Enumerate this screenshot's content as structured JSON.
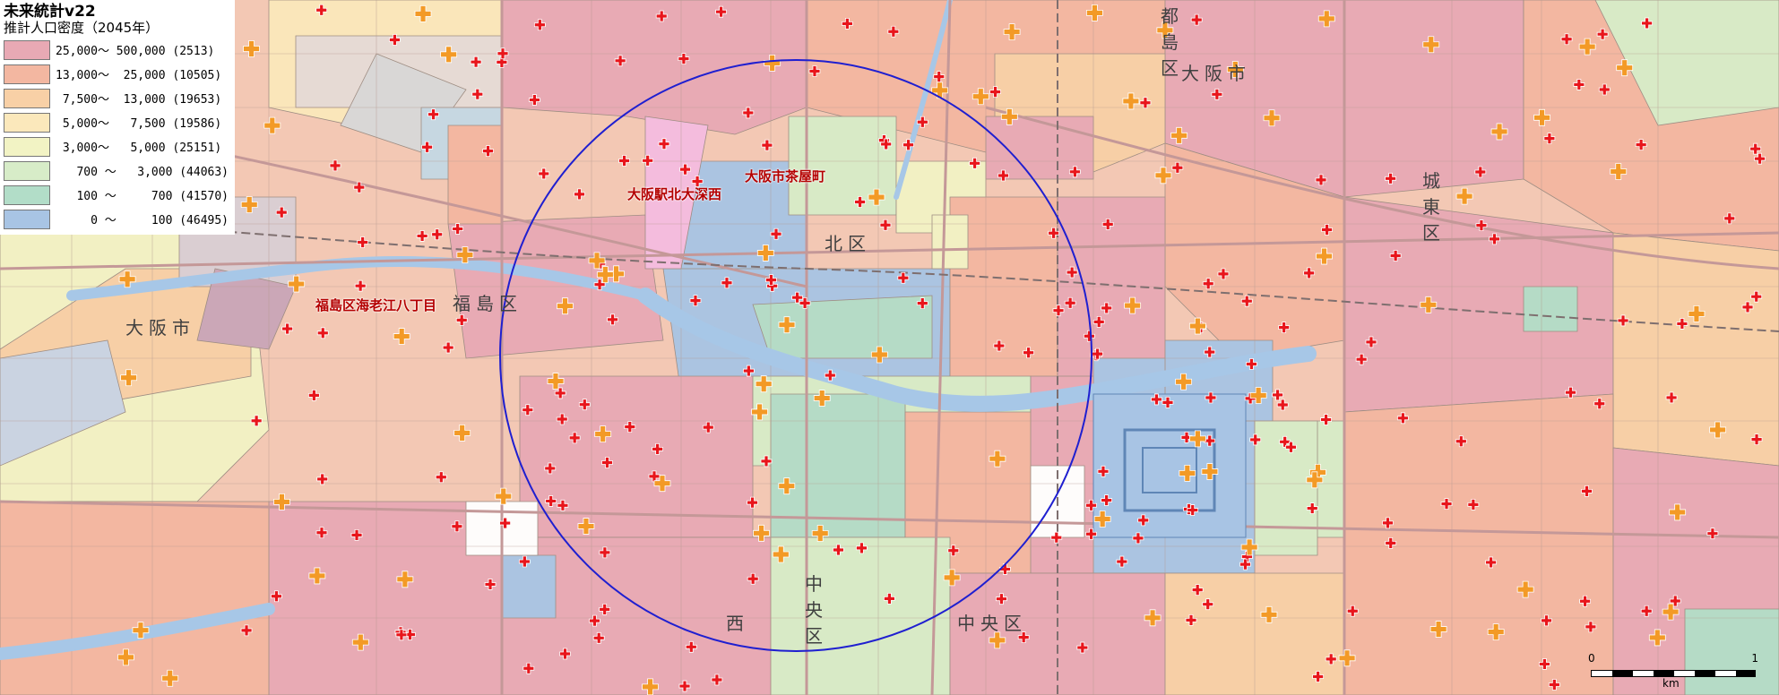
{
  "legend": {
    "title": "未来統計v22",
    "subtitle": "推計人口密度（2045年）",
    "classes": [
      {
        "range": "25,000～ 500,000 (2513)",
        "color": "#e8a9b4"
      },
      {
        "range": "13,000～  25,000 (10505)",
        "color": "#f3b7a1"
      },
      {
        "range": " 7,500～  13,000 (19653)",
        "color": "#f8d0a6"
      },
      {
        "range": " 5,000～   7,500 (19586)",
        "color": "#fbe8bb"
      },
      {
        "range": " 3,000～   5,000 (25151)",
        "color": "#f2f3c4"
      },
      {
        "range": "   700 ～   3,000 (44063)",
        "color": "#d7ecc8"
      },
      {
        "range": "   100 ～     700 (41570)",
        "color": "#b2ddc8"
      },
      {
        "range": "     0 ～     100 (46495)",
        "color": "#a8c4e4"
      }
    ]
  },
  "labels": {
    "station_kita": "大阪駅北大深西",
    "chayamachi": "大阪市茶屋町",
    "fukushima_ebie": "福島区海老江八丁目",
    "fukushima_ku": "福島区",
    "osaka_city_left": "大阪市",
    "osaka_city_right": "大阪市",
    "miyakojima_ku": "都島区",
    "joto_ku": "城東区",
    "kita_ku": "北区",
    "chuo_ku_center": "中央区",
    "chuo_ku_right": "中央区",
    "nishi_ku": "西"
  },
  "scale": {
    "zero": "0",
    "one": "1",
    "unit": "km"
  },
  "colors": {
    "circle": "#1f1fd0",
    "hospital": "#e8151b",
    "clinic": "#f39a26",
    "road_main": "#c9a0a0",
    "river": "#a7c7e7"
  }
}
